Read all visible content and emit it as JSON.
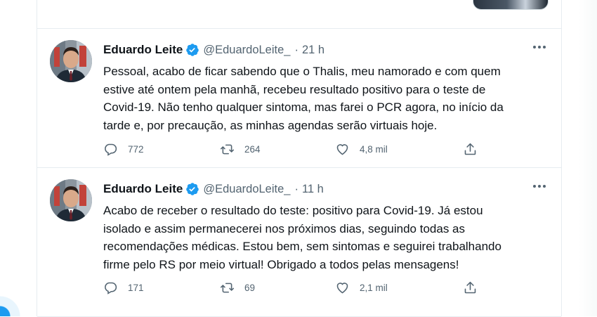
{
  "tweets": [
    {
      "author": {
        "name": "Eduardo Leite",
        "handle": "@EduardoLeite_",
        "verified": true
      },
      "time": "21 h",
      "text": [
        "Pessoal, acabo de ficar sabendo que o Thalis, meu namorado e com quem",
        "estive até ontem pela manhã, recebeu resultado positivo para o teste de",
        "Covid-19. Não tenho qualquer sintoma, mas farei o PCR agora, no início da",
        "tarde e, por precaução, as minhas agendas serão virtuais hoje."
      ],
      "stats": {
        "replies": "772",
        "retweets": "264",
        "likes": "4,8 mil"
      }
    },
    {
      "author": {
        "name": "Eduardo Leite",
        "handle": "@EduardoLeite_",
        "verified": true
      },
      "time": "11 h",
      "text": [
        "Acabo de receber o resultado do teste: positivo para Covid-19. Já estou",
        "isolado e assim permanecerei nos próximos dias, seguindo todas as",
        "recomendações médicas. Estou bem, sem sintomas e seguirei trabalhando",
        "firme pelo RS por meio virtual! Obrigado a todos pelas mensagens!"
      ],
      "stats": {
        "replies": "171",
        "retweets": "69",
        "likes": "2,1 mil"
      }
    }
  ],
  "separator": "·",
  "icons": {
    "verified": "verified-badge-icon",
    "more": "more-dots-icon",
    "reply": "reply-icon",
    "retweet": "retweet-icon",
    "like": "heart-icon",
    "share": "share-icon"
  },
  "colors": {
    "accent": "#1d9bf0",
    "text": "#0f1419",
    "secondary": "#536471",
    "border": "#e6ecf0"
  }
}
